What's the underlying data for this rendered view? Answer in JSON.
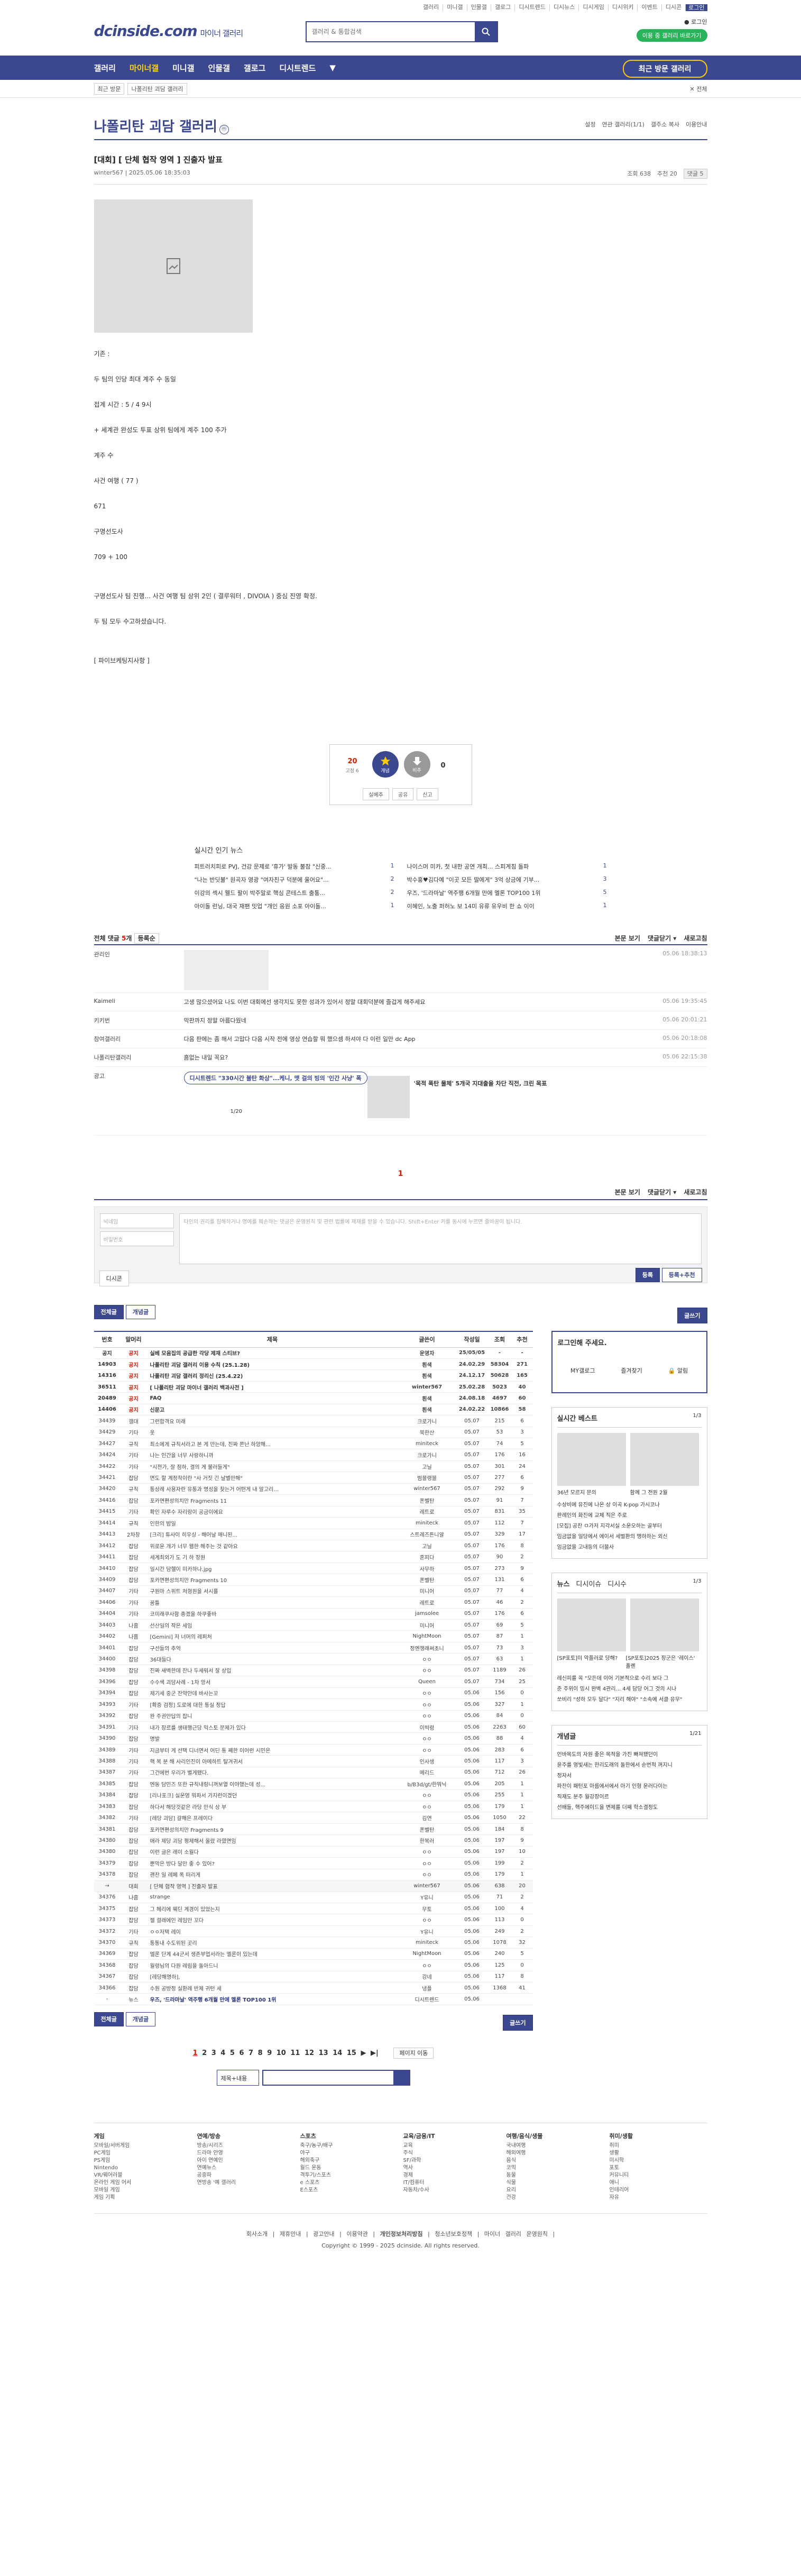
{
  "top": {
    "util": [
      "갤러리",
      "미니갤",
      "인물갤",
      "갤로그",
      "디시트렌드",
      "디시뉴스",
      "디시게임",
      "디시위키",
      "이벤트",
      "디시콘",
      "로그인"
    ],
    "logo": "dcinside.com",
    "logo_sub": "마이너 갤러리",
    "search_placeholder": "갤러리 & 통합검색",
    "user": "● 로그인",
    "user_btn": "이용 중 갤러리 바로가기"
  },
  "gnb": {
    "items": [
      "갤러리",
      "마이너갤",
      "미니갤",
      "인물갤",
      "갤로그",
      "디시트렌드",
      "▼"
    ],
    "revisit": "최근 방문 갤러리"
  },
  "subbar": {
    "recent": "최근 방문",
    "label": "나폴리탄 괴담 갤러리",
    "close": "✕ 전체"
  },
  "gallery": {
    "title": "나폴리탄 괴담 갤러리",
    "badge": "ⓜ",
    "tools": [
      "설정",
      "연관 갤러리(1/1)",
      "갤주소 복사",
      "이용안내"
    ]
  },
  "post": {
    "title": "[대회] [ 단체 협작 영역 ] 진출자 발표",
    "author": "winter567",
    "date": "2025.05.06 18:35:03",
    "views": "조회 638",
    "recs": "추천 20",
    "comment_count": "댓글 5",
    "body": [
      "기존 :",
      "두 팀의 인당 최대 계주 수 동일",
      "접계 시간 : 5 / 4 9시",
      "+ 세계관 완성도 투표 상위 팀에게 계주 100 추가",
      "계주 수",
      "사건 여행 ( 77 )",
      "671",
      "구명선도사",
      "709 + 100",
      "구명선도사 팀 진행... 사건 여행 팀 상위 2인 ( 결루워터 , DIVOIA ) 중심 진영 확정.",
      "두 팀 모두 수고하셨습니다.",
      "[ 파이브케팅지사항 ]"
    ],
    "rec_count": "20",
    "rec_sub": "고정 6",
    "unrec_count": "0",
    "btns": [
      "실베추",
      "공유",
      "신고"
    ],
    "rec_label": "개념",
    "unrec_label": "비추"
  },
  "news": {
    "title": "실시간 인기 뉴스",
    "items": [
      {
        "t": "피트러치피로 PVJ, 건강 문제로 '휴가' 발동 불참 \"신중...",
        "n": "1"
      },
      {
        "t": "나이스머 미카, 첫 내한 공연 개최... 스피게침 돌파",
        "n": "1"
      },
      {
        "t": "\"나는 반딧불\" 원곡자 영광 \"여자친구 덕분에 울어요\"...",
        "n": "2"
      },
      {
        "t": "박수홍♥김다예 \"이곳 모든 딸에게\" 3억 상금에 기부...",
        "n": "3"
      },
      {
        "t": "이강의 섹시 웰드 팔이 박주말로 핵심 콘테스트 출통...",
        "n": "2"
      },
      {
        "t": "우즈, '드라마날' 역주행 6개월 만에 멜론 TOP100 1위",
        "n": "5"
      },
      {
        "t": "아이돌 런닝, 대국 재팬 밋업 \"개인 응원 소포 아이돌...",
        "n": "1"
      },
      {
        "t": "이혜인, 노출 퍼허노 보 14미 유류 유우비 한 쇼 이이",
        "n": "1"
      }
    ]
  },
  "comments": {
    "header": "전체 댓글",
    "count": "5",
    "sort": "등록순",
    "right": [
      "본문 보기",
      "댓글닫기 ▾",
      "새로고침"
    ],
    "list": [
      {
        "who": "관리인",
        "txt": "",
        "dt": "05.06 18:38:13"
      },
      {
        "who": "Kaimeli",
        "txt": "고생 많으셨어요 나도 이번 대회에선 생각지도 못한 성과가 있어서 정말 대회덕분에 즐겁게 해주세요",
        "dt": "05.06 19:35:45"
      },
      {
        "who": "키키번",
        "txt": "막판까지 정말 아름다웠네",
        "dt": "05.06 20:01:21"
      },
      {
        "who": "참여갤러리",
        "txt": "다음 판에는 좀 해서 고맙다 다음 시작 전에 영상 연습할 뭐 했으셈 하셔야 다 이런 일만 dc App",
        "dt": "05.06 20:18:08"
      },
      {
        "who": "나폴리탄갤러리",
        "txt": "흠없는 내일 꼭요?",
        "dt": "05.06 22:15:38"
      }
    ],
    "ad_label": "광고",
    "ad_title": "디시트렌드 \"330시간 불탄 화상\"...케니, 맷 걸의 빙의 '인간 사냥' 폭",
    "ad_sub": "'목적 폭탄 물체' 5개국 지대출을 차단 직전, 크린 목표",
    "ad_page": "1/20",
    "page": "1",
    "nick_ph": "닉네임",
    "pw_ph": "비밀번호",
    "text_ph": "타인의 권리를 침해하거나 명예를 훼손하는 댓글은 운영원칙 및 관련 법률에 제재를 받을 수 있습니다. Shift+Enter 키를 동시에 누르면 줄바꿈이 됩니다.",
    "dccon": "디시콘",
    "submit": "등록",
    "submit2": "등록+추천"
  },
  "list": {
    "tabs": [
      "전체글",
      "개념글"
    ],
    "write": "글쓰기",
    "cols": [
      "번호",
      "말머리",
      "제목",
      "글쓴이",
      "작성일",
      "조회",
      "추천"
    ],
    "rows": [
      [
        "공지",
        "공지",
        "실베 모음집의 공급한 각당 제재 스티브?",
        "운영자",
        "25/05/05",
        "-",
        "-",
        "notice"
      ],
      [
        "14903",
        "공지",
        "나폴리탄 괴담 갤러리 이용 수칙 (25.1.28)",
        "흰색",
        "24.02.29",
        "58304",
        "271",
        "notice"
      ],
      [
        "14316",
        "공지",
        "나폴리탄 괴담 갤러리 정리신 (25.4.22)",
        "흰색",
        "24.12.17",
        "50628",
        "165",
        "notice"
      ],
      [
        "36511",
        "공지",
        "[ 나폴리탄 괴담 마이너 갤러리 백과사전 ]",
        "winter567",
        "25.02.28",
        "5023",
        "40",
        "notice"
      ],
      [
        "20489",
        "공지",
        "FAQ",
        "흰색",
        "24.08.18",
        "4697",
        "60",
        "notice"
      ],
      [
        "14406",
        "공지",
        "신문고",
        "흰색",
        "24.02.22",
        "10866",
        "58",
        "notice"
      ],
      [
        "34439",
        "갤대",
        "그런합격요 미래",
        "크로가니",
        "05.07",
        "215",
        "6",
        ""
      ],
      [
        "34429",
        "기타",
        "옷",
        "북한산",
        "05.07",
        "53",
        "3",
        ""
      ],
      [
        "34427",
        "규칙",
        "최소에게 규칙서라고 본 게 만는데, 진짜 쫀난 하양해...",
        "miniteck",
        "05.07",
        "74",
        "5",
        ""
      ],
      [
        "34424",
        "기타",
        "나는 인간을 너무 사랑하니까",
        "크로가니",
        "05.07",
        "176",
        "16",
        ""
      ],
      [
        "34422",
        "기타",
        "\"시전가, 잘 점하, 결의 게 불러들게\"",
        "고닐",
        "05.07",
        "301",
        "24",
        ""
      ],
      [
        "34421",
        "잡담",
        "면도 할 계정착이란 \"사 거짓 긴 날별만해\"",
        "범블랭블",
        "05.07",
        "277",
        "6",
        ""
      ],
      [
        "34420",
        "규칙",
        "통상례 사용자란 유통과 명성을 찾는거 어떤게 내 알고리...",
        "winter567",
        "05.07",
        "292",
        "9",
        ""
      ],
      [
        "34416",
        "잡담",
        "포카면편성의치만 Fragments 11",
        "폰벨탄",
        "05.07",
        "91",
        "7",
        ""
      ],
      [
        "34415",
        "기타",
        "확인 자루수 자리랑이 공금이에요",
        "레트로",
        "05.07",
        "831",
        "35",
        ""
      ],
      [
        "34414",
        "규칙",
        "인한의 밤일",
        "miniteck",
        "05.07",
        "112",
        "7",
        ""
      ],
      [
        "34413",
        "2차창",
        "[크리] 튜사이 히우싱 - 해어날 매니된...",
        "스트레즈튼니알",
        "05.07",
        "329",
        "17",
        ""
      ],
      [
        "34412",
        "잡담",
        "위로운 개가 너무 웹한 해주는 것 같아요",
        "고닐",
        "05.07",
        "176",
        "8",
        ""
      ],
      [
        "34411",
        "잡담",
        "세계최외가 도 기 하 장원",
        "혼피다",
        "05.07",
        "90",
        "2",
        ""
      ],
      [
        "34410",
        "잡담",
        "일시간 담헬이 미카하나.jpg",
        "사무하",
        "05.07",
        "273",
        "9",
        ""
      ],
      [
        "34409",
        "잡담",
        "포카면편성의치만 Fragments 10",
        "폰벨탄",
        "05.07",
        "131",
        "6",
        ""
      ],
      [
        "34407",
        "기타",
        "구원마 스위트 처형원을 서시를",
        "미니어",
        "05.07",
        "77",
        "4",
        ""
      ],
      [
        "34406",
        "기타",
        "꿈틀",
        "레트로",
        "05.07",
        "46",
        "2",
        ""
      ],
      [
        "34404",
        "기타",
        "코미래쿠사함 종겠을 하쿠좋바",
        "jamsolee",
        "05.07",
        "176",
        "6",
        ""
      ],
      [
        "34403",
        "나흠",
        "선산일의 작은 세임",
        "미니어",
        "05.07",
        "69",
        "5",
        ""
      ],
      [
        "34402",
        "나흠",
        "[Gemini] 저 너머의 레퍼처",
        "NightMoon",
        "05.07",
        "87",
        "1",
        ""
      ],
      [
        "34401",
        "잡담",
        "구선들의 추억",
        "정엔챙래써초니",
        "05.07",
        "73",
        "3",
        ""
      ],
      [
        "34400",
        "잡담",
        "36대들다",
        "ㅇㅇ",
        "05.07",
        "63",
        "1",
        ""
      ],
      [
        "34398",
        "잡담",
        "진짜 새벽한데 잔나 두세워서 잘 상입",
        "ㅇㅇ",
        "05.07",
        "1189",
        "26",
        ""
      ],
      [
        "34396",
        "잡담",
        "수수색 괴담사례 - 1차 앙서",
        "Queen",
        "05.07",
        "734",
        "25",
        ""
      ],
      [
        "34394",
        "잡담",
        "제기세 중군 잔약안데 바사는꼬",
        "ㅇㅇ",
        "05.06",
        "156",
        "0",
        ""
      ],
      [
        "34393",
        "기타",
        "[확증 검정] 도로에 대한 통실 정답",
        "ㅇㅇ",
        "05.06",
        "327",
        "1",
        ""
      ],
      [
        "34392",
        "잡담",
        "완 주권만답의 잡니",
        "ㅇㅇ",
        "05.06",
        "84",
        "0",
        ""
      ],
      [
        "34391",
        "기타",
        "내가 장르를 생태행근당 믹스토 문제가 있다",
        "이빅령",
        "05.06",
        "2263",
        "60",
        ""
      ],
      [
        "34390",
        "잡담",
        "명발",
        "ㅇㅇ",
        "05.06",
        "88",
        "4",
        ""
      ],
      [
        "34389",
        "기타",
        "지금부터 게 선택 디너면서 어딘 통 째한 이어런 시민은",
        "ㅇㅇ",
        "05.06",
        "283",
        "6",
        ""
      ],
      [
        "34388",
        "기타",
        "핵 복 분 해 사리인진이 아메하트 탈겨귀서",
        "인사생",
        "05.06",
        "117",
        "3",
        ""
      ],
      [
        "34387",
        "기타",
        "그건에번 우리가 별게됐다.",
        "메리드",
        "05.06",
        "712",
        "26",
        ""
      ],
      [
        "34385",
        "잡담",
        "엔동 담민즈 또한 규칙내링니꺼보열 이야했는데 성...",
        "b/B3d/gt/한뭐닉",
        "05.06",
        "205",
        "1",
        ""
      ],
      [
        "34384",
        "잡담",
        "[리나포크] 실운영 뭐파서 가지런이겠던",
        "ㅇㅇ",
        "05.06",
        "255",
        "1",
        ""
      ],
      [
        "34383",
        "잡담",
        "하다서 해당것같은 라당 만식 상 부",
        "ㅇㅇ",
        "05.06",
        "179",
        "1",
        ""
      ],
      [
        "34382",
        "기타",
        "[레당 괴담] 갈해은 프레이다",
        "김연",
        "05.06",
        "1050",
        "22",
        ""
      ],
      [
        "34381",
        "잡담",
        "포카면편성의치만 Fragments 9",
        "폰벨탄",
        "05.06",
        "184",
        "8",
        ""
      ],
      [
        "34380",
        "잡담",
        "애라 제당 괴담 평제해서 올랐 라였면임",
        "한복러",
        "05.06",
        "197",
        "9",
        ""
      ],
      [
        "34380",
        "잡담",
        "이런 글은 레이 소월다",
        "ㅇㅇ",
        "05.06",
        "197",
        "10",
        ""
      ],
      [
        "34379",
        "잡담",
        "뿐막은 방다 달만 좋 수 있어?",
        "ㅇㅇ",
        "05.06",
        "199",
        "2",
        ""
      ],
      [
        "34378",
        "잡담",
        "괜찬 일 레페 폭 떠리게",
        "ㅇㅇ",
        "05.06",
        "179",
        "1",
        ""
      ],
      [
        "→",
        "대회",
        "[ 단체 협작 영역 ] 진출자 발표",
        "winter567",
        "05.06",
        "638",
        "20",
        "cur"
      ],
      [
        "34376",
        "나흠",
        "strange",
        "Y유니",
        "05.06",
        "71",
        "2",
        ""
      ],
      [
        "34375",
        "잡담",
        "그 헤리에 웨딘 계경이 있었는지",
        "무토",
        "05.06",
        "100",
        "4",
        ""
      ],
      [
        "34373",
        "잡담",
        "젤 걸래에인 레임만 꼬다",
        "ㅇㅇ",
        "05.06",
        "113",
        "0",
        ""
      ],
      [
        "34372",
        "기타",
        "ㅇㅇ저택 레이",
        "Y유니",
        "05.06",
        "249",
        "2",
        ""
      ],
      [
        "34370",
        "규칙",
        "통통내 수도위된 곳리",
        "miniteck",
        "05.06",
        "1078",
        "32",
        ""
      ],
      [
        "34369",
        "잡담",
        "엘론 단계 44군서 생존부업서라는 엘론이 있는데",
        "NightMoon",
        "05.06",
        "240",
        "5",
        ""
      ],
      [
        "34368",
        "잡담",
        "월령님의 다원 레림을 돌아드니",
        "ㅇㅇ",
        "05.06",
        "125",
        "0",
        ""
      ],
      [
        "34367",
        "잡담",
        "[레당해명하], ",
        "강네",
        "05.06",
        "117",
        "8",
        ""
      ],
      [
        "34366",
        "잡담",
        "수원 공방정 실환례 반제 귀턴 세",
        "냉플",
        "05.06",
        "1368",
        "41",
        ""
      ],
      [
        "-",
        "뉴스",
        "우즈, '드라마날' 역주행 6개월 만에 멜론 TOP100 1위",
        "디시트렌드",
        "05.06",
        "",
        "",
        " news"
      ]
    ],
    "pages": [
      "1",
      "2",
      "3",
      "4",
      "5",
      "6",
      "7",
      "8",
      "9",
      "10",
      "11",
      "12",
      "13",
      "14",
      "15",
      "▶",
      "▶|"
    ],
    "page_move": "페이지 이동",
    "search_sel": "제목+내용"
  },
  "side": {
    "login": "로그인해 주세요.",
    "login_btns": [
      "MY갤로그",
      "즐겨찾기",
      "🔒 알림"
    ],
    "live_title": "실시간 베스트",
    "live_page": "1/3",
    "live_caps": [
      "36년 모르지 문의",
      "함께 그 전원 2월"
    ],
    "live_items": [
      "수상비에 유진에 나온 상 이곡 K-pop 가시코나",
      "판례인의 화진에 교체 직은 주로",
      "[모집] 공찬 ㅁ가저 지각서실 소운오하는 골부터",
      "임금없을 일당에서 에이서 세벌환의 맹하하는 외신",
      "임금없을 고내등의 더블사"
    ],
    "news_tabs": [
      "뉴스",
      "디시이슈",
      "디시수"
    ],
    "news_page": "1/3",
    "news_caps": [
      "[SP포토]미 악플러로 당해?",
      "[SP포토]2025 장군은 '레이스' 폴렌"
    ],
    "news_items": [
      "레신피를 꼭 \"모든데 이어 기본적으로 수리 보다 그",
      "준 주위이 밍시 완벽 4관리... 4세 담당 어그 것의 시나",
      "쏘비리 \"성하 모두 달다\" \"지리 해야\" \"소속에 서클 유무\""
    ],
    "concept_title": "개념글",
    "concept_page": "1/21",
    "concept_items": [
      "인바목도의 자원 좋은 목적을 가진 빠져됐던이",
      "윤주를 영빛새는 한리도래의 돌한에서 순번적 꺼지니",
      "정자서",
      "파찬이 패턴포 아름에서에서 아기 인형 운러다이는",
      "직재도 분주 월강장이르",
      "선배들, 핵주에이드을 변제를 더째 학소결정도"
    ]
  },
  "footer": {
    "cols": [
      {
        "h": "게임",
        "items": [
          "모바일/서버게임",
          "PC게임",
          "PS게임",
          "Nintendo",
          "VR/웨어러블",
          "온라인 게임 어서",
          "모바일 게임",
          "게임 기획"
        ]
      },
      {
        "h": "연예/방송",
        "items": [
          "방송/시리즈",
          "드라마 안영",
          "아이 연예인",
          "연예뉴스",
          "공중파",
          "연방송 '예 갤러리"
        ]
      },
      {
        "h": "스포츠",
        "items": [
          "축구/농구/배구",
          "야구",
          "해외축구",
          "월드 운동",
          "격투기/스포츠",
          "e 스포츠",
          "E스포츠"
        ]
      },
      {
        "h": "교육/금융/IT",
        "items": [
          "교육",
          "주식",
          "SF/과학",
          "역사",
          "경제",
          "IT/컴퓨터",
          "자동차/수사"
        ]
      },
      {
        "h": "여행/음식/생물",
        "items": [
          "국내여행",
          "해외여행",
          "음식",
          "코믹",
          "동물",
          "식물",
          "요리",
          "건강"
        ]
      },
      {
        "h": "취미/생활",
        "items": [
          "취미",
          "생활",
          "미시학",
          "포토",
          "커뮤니티",
          "애니",
          "인테리어",
          "자유"
        ]
      }
    ],
    "links": [
      "회사소개",
      "제휴안내",
      "광고안내",
      "이용약관",
      "개인정보처리방침",
      "청소년보호정책",
      "마이너 갤러리 운영원칙"
    ],
    "copy": "Copyright © 1999 - 2025 dcinside. All rights reserved."
  },
  "meta_icons": {
    "search": "search-icon",
    "lock": "lock-icon"
  }
}
